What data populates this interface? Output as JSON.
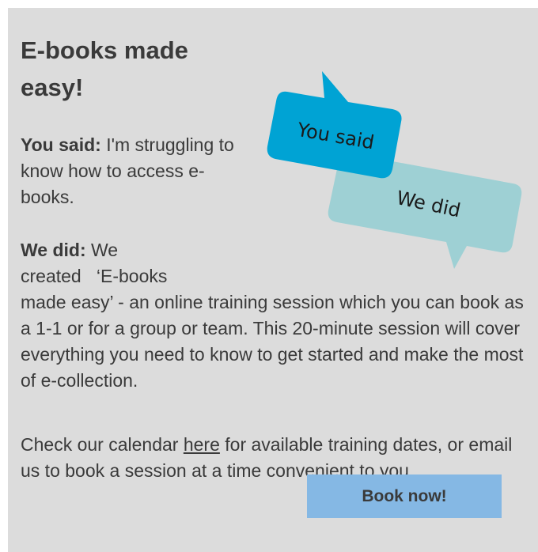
{
  "card": {
    "title": "E-books made easy!",
    "you_said": {
      "label": "You said:",
      "text": "I'm struggling to know how to access e-books."
    },
    "we_did": {
      "label": "We did:",
      "text_line1": "We",
      "text_line2": "created   ‘E-books",
      "text_rest": "made easy’ - an online training session which you can book as a 1-1 or for a group or team. This 20-minute session will cover everything you need to know to get started and make the most of e-collection."
    },
    "calendar": {
      "prefix": "Check our calendar ",
      "link_text": "here",
      "suffix": " for available training dates, or email us to book a session at a time convenient to you."
    },
    "bubbles": {
      "you_said_label": "You said",
      "we_did_label": "We did",
      "you_said_color": "#00a3d4",
      "we_did_color": "#9ed0d4"
    },
    "button_label": "Book now!",
    "button_color": "#85b8e4",
    "background_color": "#dcdcdc"
  }
}
